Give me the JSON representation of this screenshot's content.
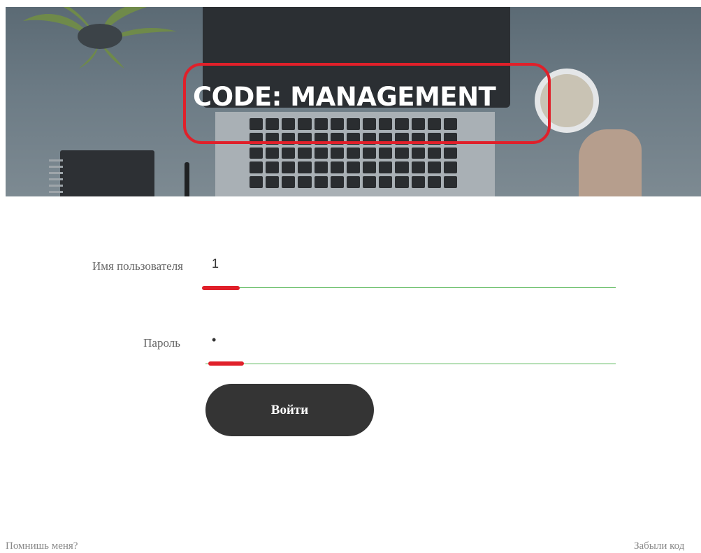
{
  "header": {
    "title": "CODE: MANAGEMENT",
    "highlight_color": "#e0202a"
  },
  "form": {
    "username": {
      "label": "Имя пользователя",
      "value": "1"
    },
    "password": {
      "label": "Пароль",
      "value": "•"
    },
    "underline_color": "#5cb85c",
    "submit_label": "Войти",
    "submit_color": "#343434"
  },
  "footer": {
    "remember_me": "Помнишь меня?",
    "forgot": "Забыли код"
  }
}
